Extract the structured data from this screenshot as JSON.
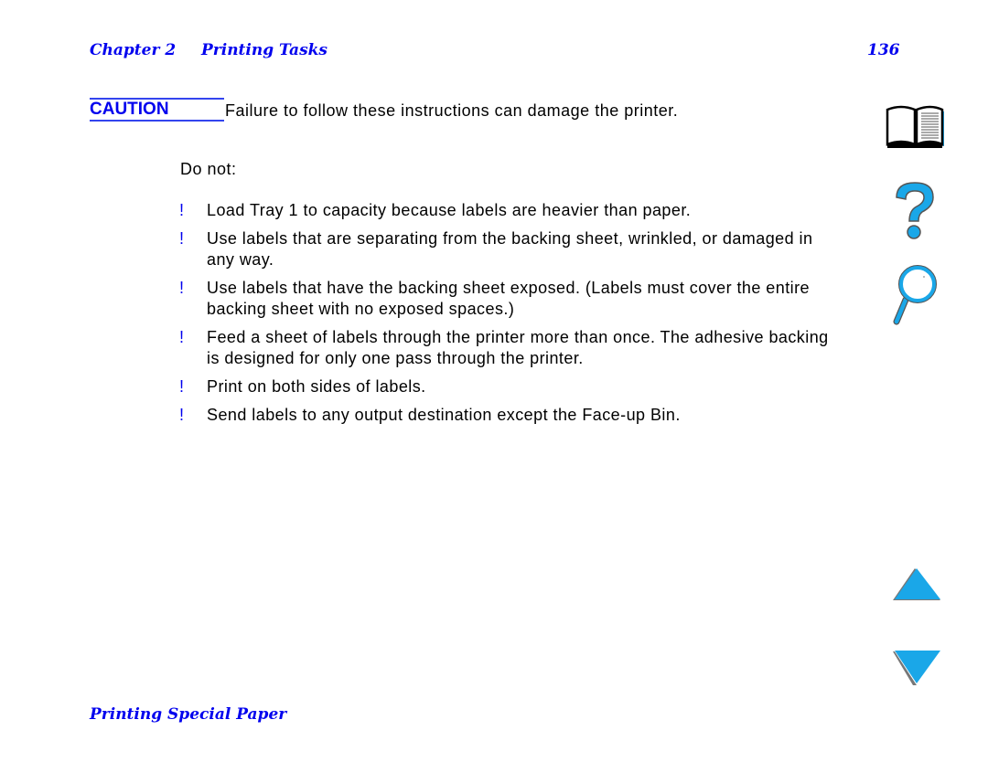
{
  "header": {
    "chapter": "Chapter 2",
    "section": "Printing Tasks",
    "page_number": "136"
  },
  "caution": {
    "label": "CAUTION",
    "text": "Failure to follow these instructions can damage the printer."
  },
  "intro": "Do not:",
  "bullet_glyph": "!",
  "items": [
    "Load Tray 1 to capacity because labels are heavier than paper.",
    "Use labels that are separating from the backing sheet, wrinkled, or damaged in any way.",
    "Use labels that have the backing sheet exposed. (Labels must cover the entire backing sheet with no exposed spaces.)",
    "Feed a sheet of labels through the printer more than once. The adhesive backing is designed for only one pass through the printer.",
    "Print on both sides of labels.",
    "Send labels to any output destination except the Face-up Bin."
  ],
  "footer": {
    "link": "Printing Special Paper"
  },
  "nav_icons": [
    "book-icon",
    "help-icon",
    "search-icon",
    "previous-page-icon",
    "next-page-icon"
  ],
  "colors": {
    "accent": "#0000ee",
    "icon_blue": "#1aa7e8"
  }
}
